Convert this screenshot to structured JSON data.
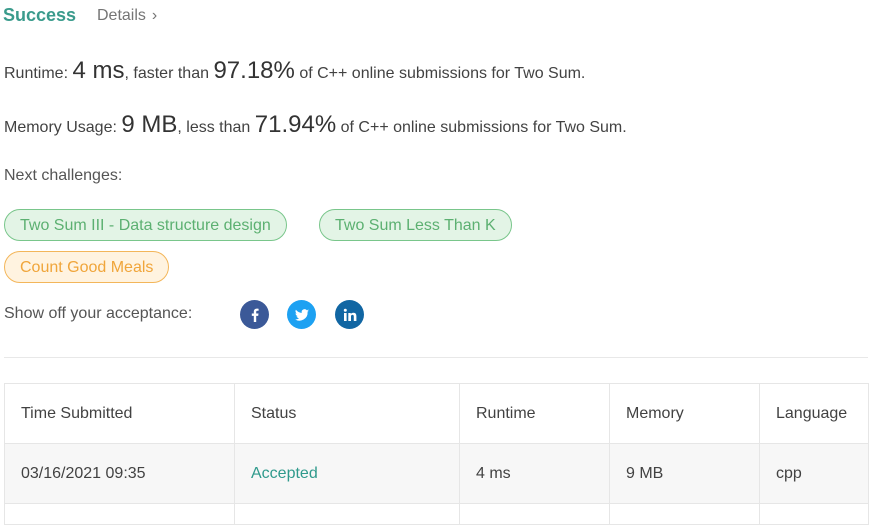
{
  "header": {
    "status": "Success",
    "details_label": "Details",
    "details_chevron": "›"
  },
  "runtime": {
    "label": "Runtime:",
    "value": "4 ms",
    "comparison": ", faster than",
    "percent": "97.18%",
    "suffix": "of C++ online submissions for Two Sum."
  },
  "memory": {
    "label": "Memory Usage:",
    "value": "9 MB",
    "comparison": ", less than",
    "percent": "71.94%",
    "suffix": "of C++ online submissions for Two Sum."
  },
  "next_challenges": {
    "label": "Next challenges:",
    "items": [
      {
        "label": "Two Sum III - Data structure design",
        "difficulty_color": "green"
      },
      {
        "label": "Two Sum Less Than K",
        "difficulty_color": "green"
      },
      {
        "label": "Count Good Meals",
        "difficulty_color": "orange"
      }
    ]
  },
  "share": {
    "label": "Show off your acceptance:",
    "icons": [
      "facebook-icon",
      "twitter-icon",
      "linkedin-icon"
    ]
  },
  "submissions": {
    "columns": [
      "Time Submitted",
      "Status",
      "Runtime",
      "Memory",
      "Language"
    ],
    "rows": [
      {
        "time": "03/16/2021 09:35",
        "status": "Accepted",
        "runtime": "4 ms",
        "memory": "9 MB",
        "language": "cpp"
      }
    ]
  },
  "colors": {
    "success": "#3a9b8c",
    "accepted": "#2f9a8c",
    "chip_green_text": "#5cb071",
    "chip_orange_text": "#f0a53a",
    "facebook": "#3b5998",
    "twitter": "#1da1f2",
    "linkedin": "#1166a3"
  }
}
